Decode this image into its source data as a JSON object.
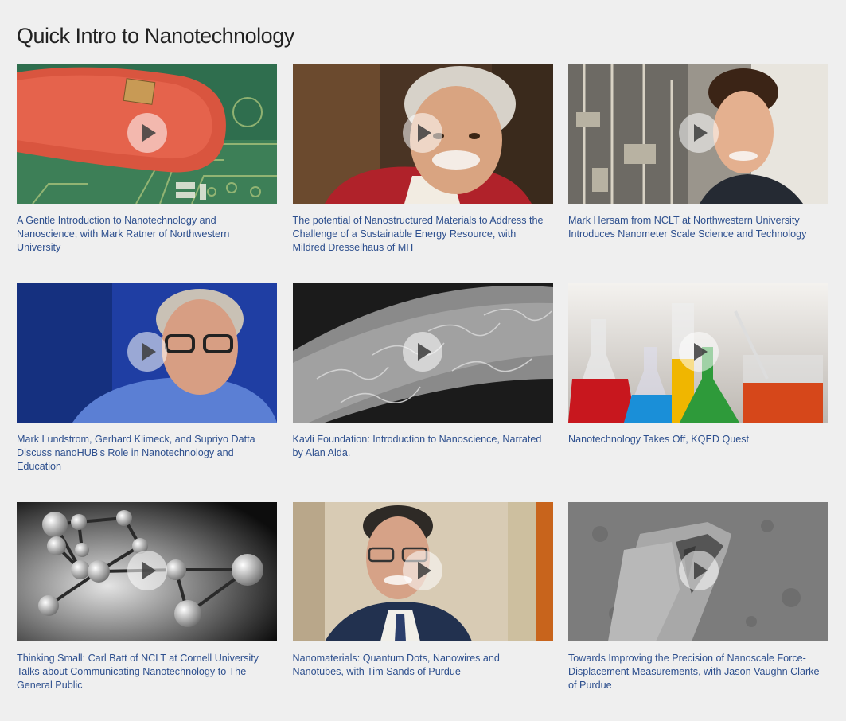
{
  "page": {
    "title": "Quick Intro to Nanotechnology"
  },
  "videos": [
    {
      "title": "A Gentle Introduction to Nanotechnology and Nanoscience, with Mark Ratner of Northwestern University",
      "thumbnail": "chip-on-fingertip"
    },
    {
      "title": "The potential of Nanostructured Materials to Address the Challenge of a Sustainable Energy Resource, with Mildred Dresselhaus of MIT",
      "thumbnail": "smiling-woman-portrait"
    },
    {
      "title": "Mark Hersam from NCLT at Northwestern University Introduces Nanometer Scale Science and Technology",
      "thumbnail": "man-in-lab-portrait"
    },
    {
      "title": "Mark Lundstrom, Gerhard Klimeck, and Supriyo Datta Discuss nanoHUB's Role in Nanotechnology and Education",
      "thumbnail": "man-with-glasses-blue-backdrop"
    },
    {
      "title": "Kavli Foundation: Introduction to Nanoscience, Narrated by Alan Alda.",
      "thumbnail": "microscope-fiber"
    },
    {
      "title": "Nanotechnology Takes Off, KQED Quest",
      "thumbnail": "colorful-lab-flasks"
    },
    {
      "title": "Thinking Small: Carl Batt of NCLT at Cornell University Talks about Communicating Nanotechnology to The General Public",
      "thumbnail": "molecule-model"
    },
    {
      "title": "Nanomaterials: Quantum Dots, Nanowires and Nanotubes, with Tim Sands of Purdue",
      "thumbnail": "man-in-suit-portrait"
    },
    {
      "title": "Towards Improving the Precision of Nanoscale Force-Displacement Measurements, with Jason Vaughn Clarke of Purdue",
      "thumbnail": "microscope-cantilever"
    }
  ],
  "icons": {
    "play": "play-button-icon"
  }
}
